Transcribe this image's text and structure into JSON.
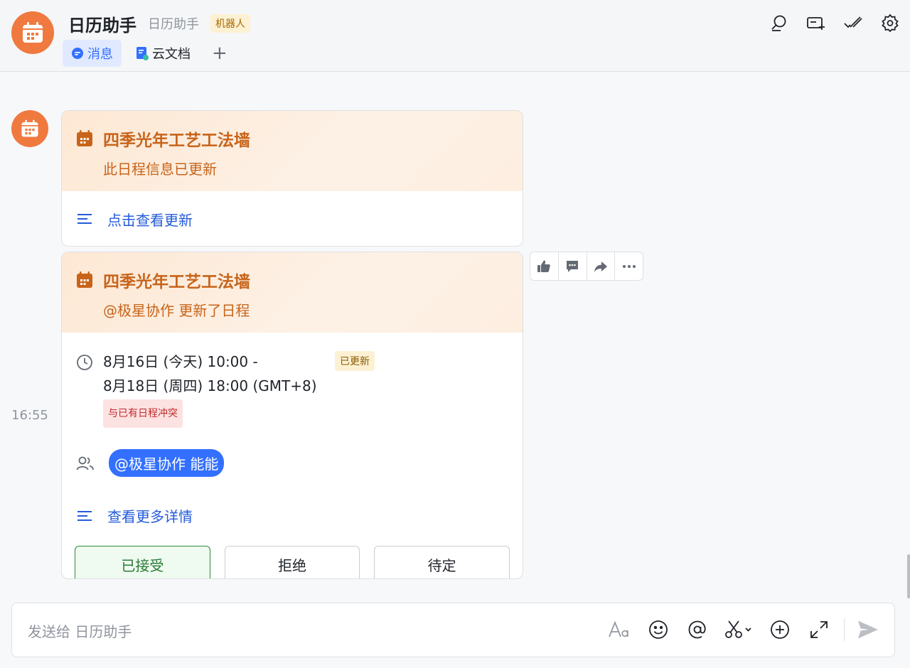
{
  "header": {
    "title": "日历助手",
    "subtitle": "日历助手",
    "bot_tag": "机器人",
    "tabs": [
      {
        "label": "消息",
        "icon": "chat-bubble-icon"
      },
      {
        "label": "云文档",
        "icon": "doc-icon"
      }
    ],
    "add_tab_symbol": "+",
    "actions": [
      "search-icon",
      "add-member-icon",
      "mark-done-icon",
      "settings-icon"
    ]
  },
  "messages": {
    "card1": {
      "title": "四季光年工艺工法墙",
      "subtitle": "此日程信息已更新",
      "link": "点击查看更新"
    },
    "card2": {
      "title": "四季光年工艺工法墙",
      "subtitle": "@极星协作 更新了日程",
      "time_line1": "8月16日 (今天) 10:00 -",
      "time_line2": "8月18日 (周四) 18:00 (GMT+8)",
      "badge_updated": "已更新",
      "badge_conflict": "与已有日程冲突",
      "attendee": "@极星协作 能能",
      "details_link": "查看更多详情",
      "buttons": {
        "accept": "已接受",
        "decline": "拒绝",
        "tentative": "待定"
      }
    },
    "timestamp": "16:55",
    "hover_actions": [
      "thumbs-up-icon",
      "reply-icon",
      "forward-icon",
      "more-icon"
    ]
  },
  "composer": {
    "placeholder": "发送给 日历助手",
    "tools": [
      "text-format-icon",
      "emoji-icon",
      "mention-icon",
      "screenshot-icon",
      "plus-icon",
      "expand-icon",
      "send-icon"
    ]
  },
  "colors": {
    "accent": "#3370ff",
    "brand_orange": "#f0793f",
    "card_title": "#c8641a",
    "accepted_green": "#2e8a3a"
  }
}
